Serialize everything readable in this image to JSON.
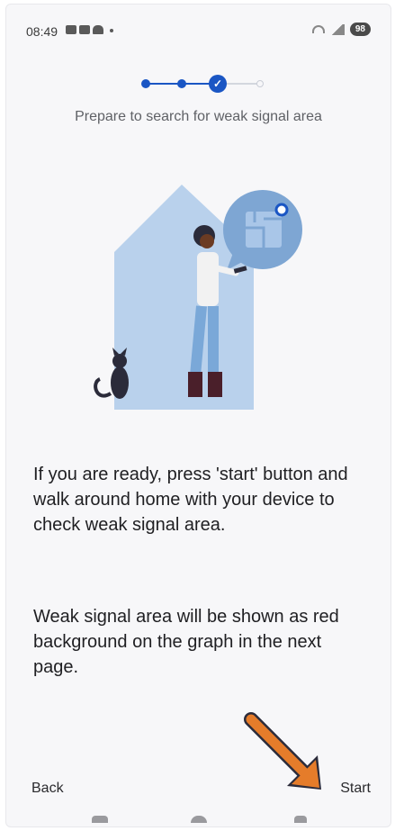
{
  "status_bar": {
    "time": "08:49",
    "battery": "98"
  },
  "stepper": {
    "current_step_mark": "✓",
    "subtitle": "Prepare to search for weak signal area"
  },
  "content": {
    "paragraph_1": "If you are ready, press 'start' button and walk around home with your device to check weak signal area.",
    "paragraph_2": "Weak signal area will be shown as red background on the graph in the next page."
  },
  "footer": {
    "back_label": "Back",
    "start_label": "Start"
  },
  "colors": {
    "accent": "#1a56c4",
    "annotation_arrow": "#e57c2a",
    "house": "#b9d1ec"
  },
  "icons": {
    "check": "check-icon",
    "arrow": "arrow-annotation-icon"
  }
}
